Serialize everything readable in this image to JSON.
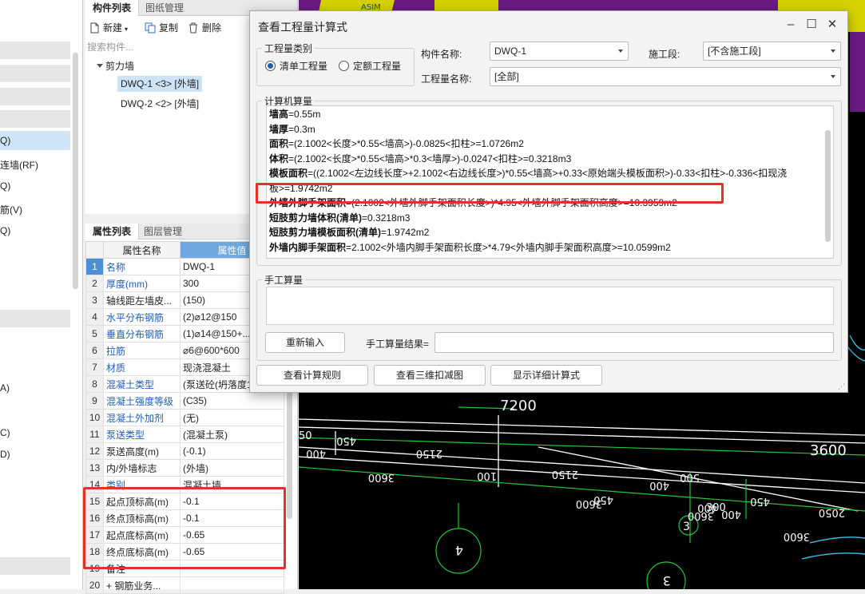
{
  "left_strip": {
    "labels": [
      "Q)",
      "连墙(RF)",
      "Q)",
      "筋(V)",
      "Q)",
      "A)",
      "C)",
      "D)"
    ]
  },
  "component_panel": {
    "tabs": [
      "构件列表",
      "图纸管理"
    ],
    "toolbar": {
      "new_label": "新建",
      "copy_label": "复制",
      "delete_label": "删除"
    },
    "search_placeholder": "搜索构件...",
    "tree": {
      "root_label": "剪力墙",
      "items": [
        {
          "label": "DWQ-1 <3> [外墙]",
          "selected": true
        },
        {
          "label": "DWQ-2 <2> [外墙]",
          "selected": false
        }
      ]
    }
  },
  "properties_panel": {
    "tabs": [
      "属性列表",
      "图层管理"
    ],
    "columns": [
      "属性名称",
      "属性值"
    ],
    "rows": [
      {
        "num": "1",
        "name": "名称",
        "value": "DWQ-1",
        "blue": true
      },
      {
        "num": "2",
        "name": "厚度(mm)",
        "value": "300",
        "blue": true
      },
      {
        "num": "3",
        "name": "轴线距左墙皮...",
        "value": "(150)",
        "blue": false
      },
      {
        "num": "4",
        "name": "水平分布钢筋",
        "value": "(2)⌀12@150",
        "blue": true
      },
      {
        "num": "5",
        "name": "垂直分布钢筋",
        "value": "(1)⌀14@150+...",
        "blue": true
      },
      {
        "num": "6",
        "name": "拉筋",
        "value": "⌀6@600*600",
        "blue": true
      },
      {
        "num": "7",
        "name": "材质",
        "value": "现浇混凝土",
        "blue": true
      },
      {
        "num": "8",
        "name": "混凝土类型",
        "value": "(泵送砼(坍落度1...",
        "blue": true
      },
      {
        "num": "9",
        "name": "混凝土强度等级",
        "value": "(C35)",
        "blue": true
      },
      {
        "num": "10",
        "name": "混凝土外加剂",
        "value": "(无)",
        "blue": true
      },
      {
        "num": "11",
        "name": "泵送类型",
        "value": "(混凝土泵)",
        "blue": true
      },
      {
        "num": "12",
        "name": "泵送高度(m)",
        "value": "(-0.1)",
        "blue": false
      },
      {
        "num": "13",
        "name": "内/外墙标志",
        "value": "(外墙)",
        "blue": false
      },
      {
        "num": "14",
        "name": "类别",
        "value": "混凝土墙",
        "blue": true
      },
      {
        "num": "15",
        "name": "起点顶标高(m)",
        "value": "-0.1",
        "blue": false
      },
      {
        "num": "16",
        "name": "终点顶标高(m)",
        "value": "-0.1",
        "blue": false
      },
      {
        "num": "17",
        "name": "起点底标高(m)",
        "value": "-0.65",
        "blue": false
      },
      {
        "num": "18",
        "name": "终点底标高(m)",
        "value": "-0.65",
        "blue": false
      },
      {
        "num": "19",
        "name": "备注",
        "value": "",
        "blue": false
      },
      {
        "num": "20",
        "name": "+ 钢筋业务...",
        "value": "",
        "blue": false
      }
    ]
  },
  "cad": {
    "dimensions": [
      "7200",
      "3600",
      "2150",
      "2150",
      "3600",
      "3600",
      "3600",
      "3600",
      "450",
      "450",
      "400",
      "400",
      "400",
      "400",
      "500",
      "100",
      "450",
      "300",
      "2050",
      "50"
    ],
    "axis_labels": [
      "3",
      "4",
      "3"
    ],
    "top_text": "ASIM"
  },
  "dialog": {
    "title": "查看工程量计算式",
    "quantity_type": {
      "legend": "工程量类别",
      "options": [
        "清单工程量",
        "定额工程量"
      ],
      "selected": "清单工程量"
    },
    "component_name_label": "构件名称:",
    "component_name_value": "DWQ-1",
    "construction_stage_label": "施工段:",
    "construction_stage_value": "[不含施工段]",
    "quantity_name_label": "工程量名称:",
    "quantity_name_value": "[全部]",
    "computer_calc": {
      "legend": "计算机算量",
      "lines": [
        {
          "key": "墙高",
          "rest": "=0.55m"
        },
        {
          "key": "墙厚",
          "rest": "=0.3m"
        },
        {
          "key": "面积",
          "rest": "=(2.1002<长度>*0.55<墙高>)-0.0825<扣柱>=1.0726m2"
        },
        {
          "key": "体积",
          "rest": "=(2.1002<长度>*0.55<墙高>*0.3<墙厚>)-0.0247<扣柱>=0.3218m3"
        },
        {
          "key": "模板面积",
          "rest": "=((2.1002<左边线长度>+2.1002<右边线长度>)*0.55<墙高>+0.33<原始端头模板面积>)-0.33<扣柱>-0.336<扣现浇"
        },
        {
          "key": "",
          "rest": "板>=1.9742m2"
        },
        {
          "key": "外墙外脚手架面积",
          "rest": "=(2.1002<外墙外脚手架面积长度>)*4.95<外墙外脚手架面积高度>=10.3959m2"
        },
        {
          "key": "短肢剪力墙体积(清单)",
          "rest": "=0.3218m3"
        },
        {
          "key": "短肢剪力墙模板面积(清单)",
          "rest": "=1.9742m2"
        },
        {
          "key": "外墙内脚手架面积",
          "rest": "=2.1002<外墙内脚手架面积长度>*4.79<外墙内脚手架面积高度>=10.0599m2"
        }
      ]
    },
    "manual_calc": {
      "legend": "手工算量",
      "reenter_label": "重新输入",
      "result_label": "手工算量结果="
    },
    "buttons": {
      "rules_label": "查看计算规则",
      "view3d_label": "查看三维扣减图",
      "detail_label": "显示详细计算式"
    }
  },
  "highlight_color": "#e8302a"
}
